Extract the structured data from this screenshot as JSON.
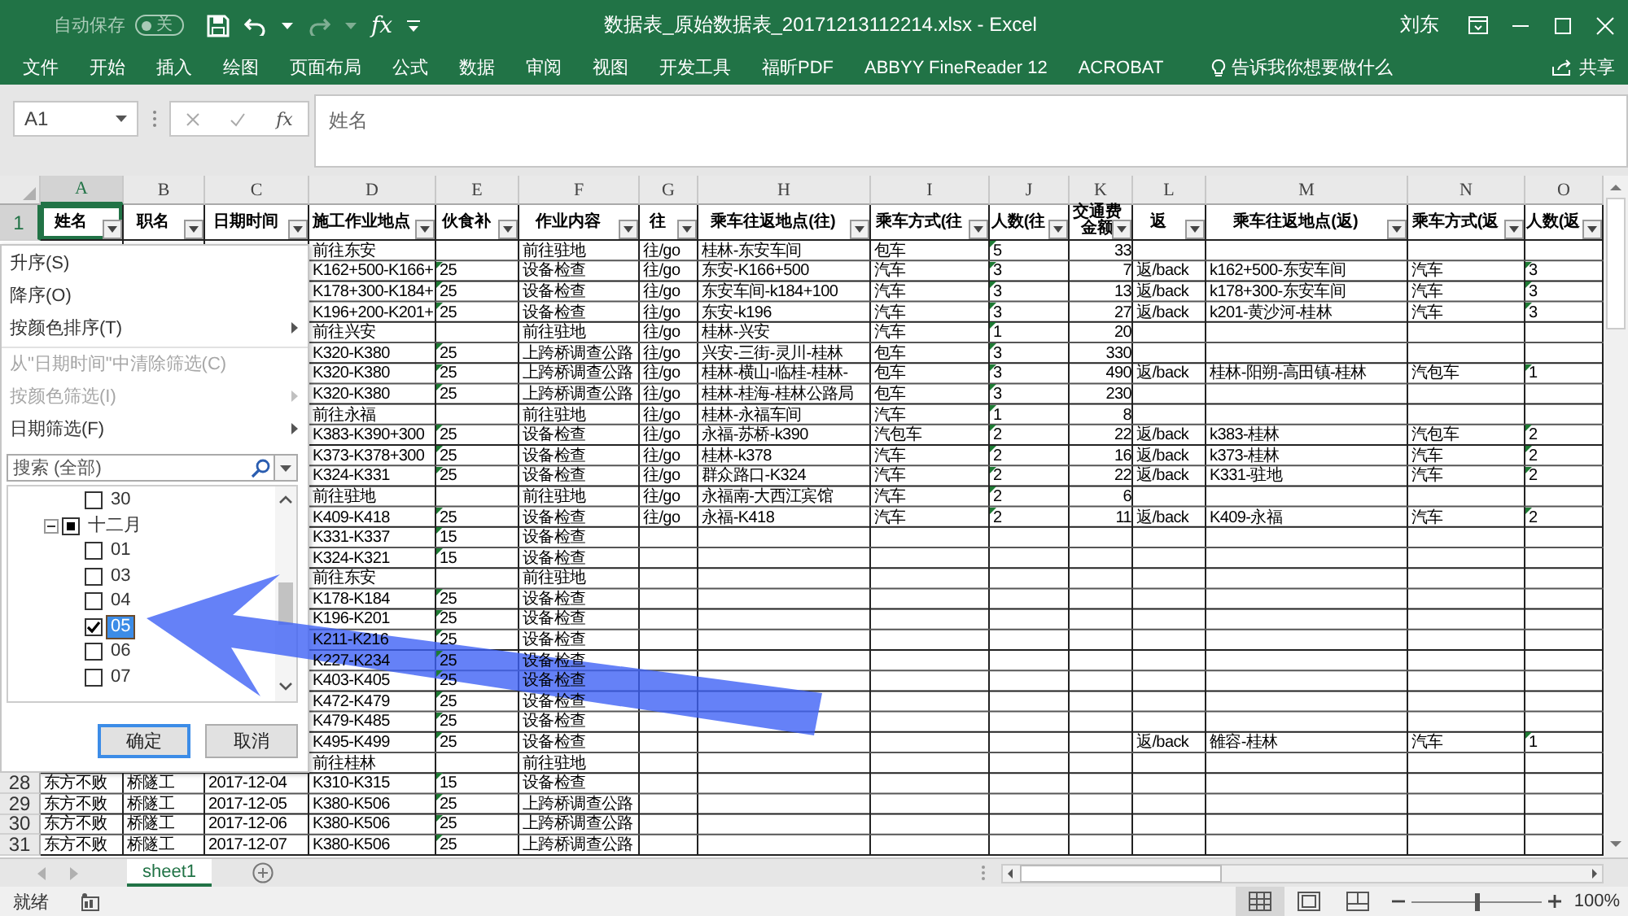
{
  "window": {
    "autosave_label": "自动保存",
    "autosave": {
      "on": false,
      "label": "关"
    },
    "function_label": "fx",
    "title": "数据表_原始数据表_20171213112214.xlsx  -  Excel",
    "user": "刘东"
  },
  "ribbon_tabs": [
    {
      "label": "文件"
    },
    {
      "label": "开始"
    },
    {
      "label": "插入"
    },
    {
      "label": "绘图"
    },
    {
      "label": "页面布局"
    },
    {
      "label": "公式"
    },
    {
      "label": "数据"
    },
    {
      "label": "审阅"
    },
    {
      "label": "视图"
    },
    {
      "label": "开发工具"
    },
    {
      "label": "福昕PDF"
    },
    {
      "label": "ABBYY FineReader 12"
    },
    {
      "label": "ACROBAT"
    }
  ],
  "tell_me": "告诉我你想要做什么",
  "share": "共享",
  "formula_bar": {
    "name_box": "A1",
    "function_label": "fx",
    "value": "姓名"
  },
  "sheet": {
    "columns": [
      "A",
      "B",
      "C",
      "D",
      "E",
      "F",
      "G",
      "H",
      "I",
      "J",
      "K",
      "L",
      "M",
      "N",
      "O"
    ],
    "header_row": {
      "num": "1",
      "selected": true,
      "cells": [
        {
          "text": "姓名",
          "selected": true
        },
        {
          "text": "职名",
          "selected": false
        },
        {
          "text": "日期时间",
          "selected": false
        },
        {
          "text": "施工作业地点",
          "selected": false
        },
        {
          "text": "伙食补",
          "selected": false
        },
        {
          "text": "作业内容",
          "selected": false
        },
        {
          "text": "往",
          "selected": false
        },
        {
          "text": "乘车往返地点(往)",
          "selected": false
        },
        {
          "text": "乘车方式(往",
          "selected": false
        },
        {
          "text": "人数(往",
          "selected": false
        },
        {
          "text": "交通费金额",
          "selected": false
        },
        {
          "text": "返",
          "selected": false
        },
        {
          "text": "乘车往返地点(返)",
          "selected": false
        },
        {
          "text": "乘车方式(返",
          "selected": false
        },
        {
          "text": "人数(返",
          "selected": false
        }
      ]
    },
    "rows": [
      {
        "cells": {
          "D": "前往东安",
          "F": "前往驻地",
          "G": "往/go",
          "H": "桂林-东安车间",
          "I": "包车",
          "J": "5",
          "K": "33"
        },
        "flags": {
          "J": true
        }
      },
      {
        "cells": {
          "D": "K162+500-K166+",
          "E": "25",
          "F": "设备检查",
          "G": "往/go",
          "H": "东安-K166+500",
          "I": "汽车",
          "J": "3",
          "K": "7",
          "L": "返/back",
          "M": "k162+500-东安车间",
          "N": "汽车",
          "O": "3"
        },
        "flags": {
          "E": true,
          "J": true,
          "O": true
        }
      },
      {
        "cells": {
          "D": "K178+300-K184+",
          "E": "25",
          "F": "设备检查",
          "G": "往/go",
          "H": "东安车间-k184+100",
          "I": "汽车",
          "J": "3",
          "K": "13",
          "L": "返/back",
          "M": "k178+300-东安车间",
          "N": "汽车",
          "O": "3"
        },
        "flags": {
          "E": true,
          "J": true,
          "O": true
        }
      },
      {
        "cells": {
          "D": "K196+200-K201+",
          "E": "25",
          "F": "设备检查",
          "G": "往/go",
          "H": "东安-k196",
          "I": "汽车",
          "J": "3",
          "K": "27",
          "L": "返/back",
          "M": "k201-黄沙河-桂林",
          "N": "汽车",
          "O": "3"
        },
        "flags": {
          "E": true,
          "J": true,
          "O": true
        }
      },
      {
        "cells": {
          "D": "前往兴安",
          "F": "前往驻地",
          "G": "往/go",
          "H": "桂林-兴安",
          "I": "汽车",
          "J": "1",
          "K": "20"
        },
        "flags": {
          "J": true
        }
      },
      {
        "cells": {
          "D": "K320-K380",
          "E": "25",
          "F": "上跨桥调查公路",
          "G": "往/go",
          "H": "兴安-三街-灵川-桂林",
          "I": "包车",
          "J": "3",
          "K": "330"
        },
        "flags": {
          "E": true,
          "J": true
        }
      },
      {
        "cells": {
          "D": "K320-K380",
          "E": "25",
          "F": "上跨桥调查公路",
          "G": "往/go",
          "H": "桂林-横山-临桂-桂林-",
          "I": "包车",
          "J": "3",
          "K": "490",
          "L": "返/back",
          "M": "桂林-阳朔-高田镇-桂林",
          "N": "汽包车",
          "O": "1"
        },
        "flags": {
          "E": true,
          "J": true,
          "O": true
        }
      },
      {
        "cells": {
          "D": "K320-K380",
          "E": "25",
          "F": "上跨桥调查公路",
          "G": "往/go",
          "H": "桂林-桂海-桂林公路局",
          "I": "包车",
          "J": "3",
          "K": "230"
        },
        "flags": {
          "E": true,
          "J": true
        }
      },
      {
        "cells": {
          "D": "前往永福",
          "F": "前往驻地",
          "G": "往/go",
          "H": "桂林-永福车间",
          "I": "汽车",
          "J": "1",
          "K": "8"
        },
        "flags": {
          "J": true
        }
      },
      {
        "cells": {
          "D": "K383-K390+300",
          "E": "25",
          "F": "设备检查",
          "G": "往/go",
          "H": "永福-苏桥-k390",
          "I": "汽包车",
          "J": "2",
          "K": "22",
          "L": "返/back",
          "M": "k383-桂林",
          "N": "汽包车",
          "O": "2"
        },
        "flags": {
          "E": true,
          "J": true,
          "O": true
        }
      },
      {
        "cells": {
          "D": "K373-K378+300",
          "E": "25",
          "F": "设备检查",
          "G": "往/go",
          "H": "桂林-k378",
          "I": "汽车",
          "J": "2",
          "K": "16",
          "L": "返/back",
          "M": "k373-桂林",
          "N": "汽车",
          "O": "2"
        },
        "flags": {
          "E": true,
          "J": true,
          "O": true
        }
      },
      {
        "cells": {
          "D": "K324-K331",
          "E": "25",
          "F": "设备检查",
          "G": "往/go",
          "H": "群众路口-K324",
          "I": "汽车",
          "J": "2",
          "K": "22",
          "L": "返/back",
          "M": "K331-驻地",
          "N": "汽车",
          "O": "2"
        },
        "flags": {
          "E": true,
          "J": true,
          "O": true
        }
      },
      {
        "cells": {
          "D": "前往驻地",
          "F": "前往驻地",
          "G": "往/go",
          "H": "永福南-大西江宾馆",
          "I": "汽车",
          "J": "2",
          "K": "6"
        },
        "flags": {
          "J": true
        }
      },
      {
        "cells": {
          "D": "K409-K418",
          "E": "25",
          "F": "设备检查",
          "G": "往/go",
          "H": "永福-K418",
          "I": "汽车",
          "J": "2",
          "K": "11",
          "L": "返/back",
          "M": "K409-永福",
          "N": "汽车",
          "O": "2"
        },
        "flags": {
          "E": true,
          "J": true,
          "O": true
        }
      },
      {
        "cells": {
          "D": "K331-K337",
          "E": "15",
          "F": "设备检查"
        },
        "flags": {
          "E": true
        }
      },
      {
        "cells": {
          "D": "K324-K321",
          "E": "15",
          "F": "设备检查"
        },
        "flags": {
          "E": true
        }
      },
      {
        "cells": {
          "D": "前往东安",
          "F": "前往驻地"
        }
      },
      {
        "cells": {
          "D": "K178-K184",
          "E": "25",
          "F": "设备检查"
        },
        "flags": {
          "E": true
        }
      },
      {
        "cells": {
          "D": "K196-K201",
          "E": "25",
          "F": "设备检查"
        },
        "flags": {
          "E": true
        }
      },
      {
        "cells": {
          "D": "K211-K216",
          "E": "25",
          "F": "设备检查"
        },
        "flags": {
          "E": true
        }
      },
      {
        "cells": {
          "D": "K227-K234",
          "E": "25",
          "F": "设备检查"
        },
        "flags": {
          "E": true
        }
      },
      {
        "cells": {
          "D": "K403-K405",
          "E": "25",
          "F": "设备检查"
        },
        "flags": {
          "E": true
        }
      },
      {
        "cells": {
          "D": "K472-K479",
          "E": "25",
          "F": "设备检查"
        },
        "flags": {
          "E": true
        }
      },
      {
        "cells": {
          "D": "K479-K485",
          "E": "25",
          "F": "设备检查"
        },
        "flags": {
          "E": true
        }
      },
      {
        "cells": {
          "D": "K495-K499",
          "E": "25",
          "F": "设备检查",
          "L": "返/back",
          "M": "雒容-桂林",
          "N": "汽车",
          "O": "1"
        },
        "flags": {
          "E": true,
          "O": true
        }
      },
      {
        "cells": {
          "D": "前往桂林",
          "F": "前往驻地"
        }
      },
      {
        "num": "28",
        "cells": {
          "A": "东方不败",
          "B": "桥隧工",
          "C": "2017-12-04",
          "D": "K310-K315",
          "E": "15",
          "F": "设备检查"
        },
        "flags": {
          "E": true
        }
      },
      {
        "num": "29",
        "cells": {
          "A": "东方不败",
          "B": "桥隧工",
          "C": "2017-12-05",
          "D": "K380-K506",
          "E": "25",
          "F": "上跨桥调查公路"
        },
        "flags": {
          "E": true
        }
      },
      {
        "num": "30",
        "cells": {
          "A": "东方不败",
          "B": "桥隧工",
          "C": "2017-12-06",
          "D": "K380-K506",
          "E": "25",
          "F": "上跨桥调查公路"
        },
        "flags": {
          "E": true
        }
      },
      {
        "num": "31",
        "cells": {
          "A": "东方不败",
          "B": "桥隧工",
          "C": "2017-12-07",
          "D": "K380-K506",
          "E": "25",
          "F": "上跨桥调查公路"
        },
        "flags": {
          "E": true
        }
      }
    ]
  },
  "filter_menu": {
    "items": [
      {
        "label": "升序(S)",
        "disabled": false,
        "submenu": false,
        "separator_before": false
      },
      {
        "label": "降序(O)",
        "disabled": false,
        "submenu": false,
        "separator_before": false
      },
      {
        "label": "按颜色排序(T)",
        "disabled": false,
        "submenu": true,
        "separator_before": false
      },
      {
        "label": "从\"日期时间\"中清除筛选(C)",
        "disabled": true,
        "submenu": false,
        "separator_before": true
      },
      {
        "label": "按颜色筛选(I)",
        "disabled": true,
        "submenu": true,
        "separator_before": false
      },
      {
        "label": "日期筛选(F)",
        "disabled": false,
        "submenu": true,
        "separator_before": false
      }
    ],
    "search": {
      "placeholder": "搜索 (全部)"
    },
    "tree": [
      {
        "label": "30",
        "checked": false,
        "selected": false
      },
      {
        "label": "十二月",
        "mixed": true,
        "selected": false,
        "expanded": true,
        "children": [
          {
            "label": "01",
            "checked": false,
            "selected": false
          },
          {
            "label": "03",
            "checked": false,
            "selected": false
          },
          {
            "label": "04",
            "checked": false,
            "selected": false
          },
          {
            "label": "05",
            "checked": true,
            "selected": true
          },
          {
            "label": "06",
            "checked": false,
            "selected": false
          },
          {
            "label": "07",
            "checked": false,
            "selected": false
          }
        ]
      }
    ],
    "buttons": [
      {
        "label": "确定",
        "default": true
      },
      {
        "label": "取消",
        "default": false
      }
    ]
  },
  "sheet_tabs": [
    {
      "label": "sheet1",
      "selected": true
    }
  ],
  "status_bar": {
    "status": "就绪",
    "views": [
      {
        "kind": "normal",
        "selected": true
      },
      {
        "kind": "page_layout",
        "selected": false
      },
      {
        "kind": "page_break",
        "selected": false
      }
    ],
    "zoom_slider": {
      "level": 0.5
    },
    "zoom": "100%"
  }
}
